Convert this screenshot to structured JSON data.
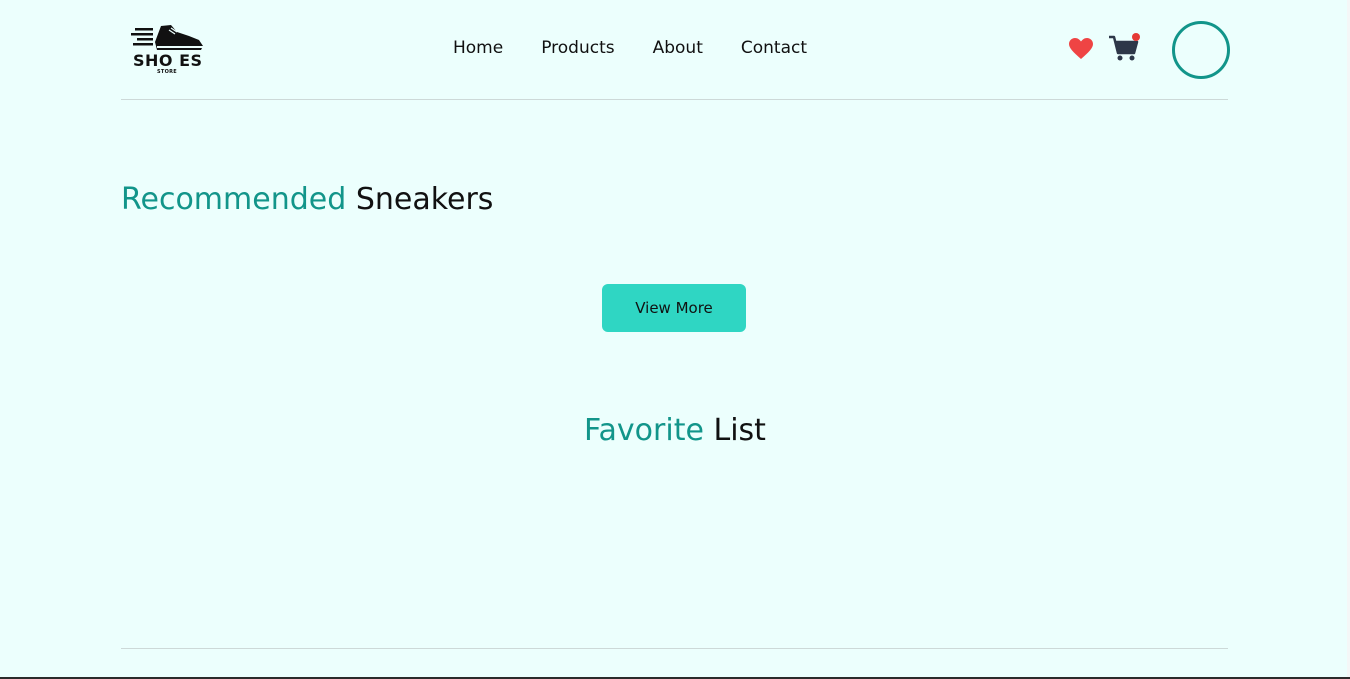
{
  "header": {
    "logo": {
      "main_text": "SHO ES",
      "sub_text": "STORE",
      "icon": "running-shoe-icon"
    },
    "nav": [
      {
        "label": "Home"
      },
      {
        "label": "Products"
      },
      {
        "label": "About"
      },
      {
        "label": "Contact"
      }
    ],
    "icons": {
      "favorites": "heart-icon",
      "cart": "cart-icon",
      "cart_badge": "notification-dot",
      "profile": "avatar"
    }
  },
  "recommended": {
    "title_accent": "Recommended",
    "title_rest": "Sneakers",
    "button_label": "View More"
  },
  "favorites": {
    "title_accent": "Favorite",
    "title_rest": "List"
  },
  "colors": {
    "background": "#ecfffd",
    "accent": "#12958a",
    "button": "#2fd6c3",
    "heart": "#ef4444",
    "cart": "#2d3748",
    "badge": "#e53935"
  }
}
